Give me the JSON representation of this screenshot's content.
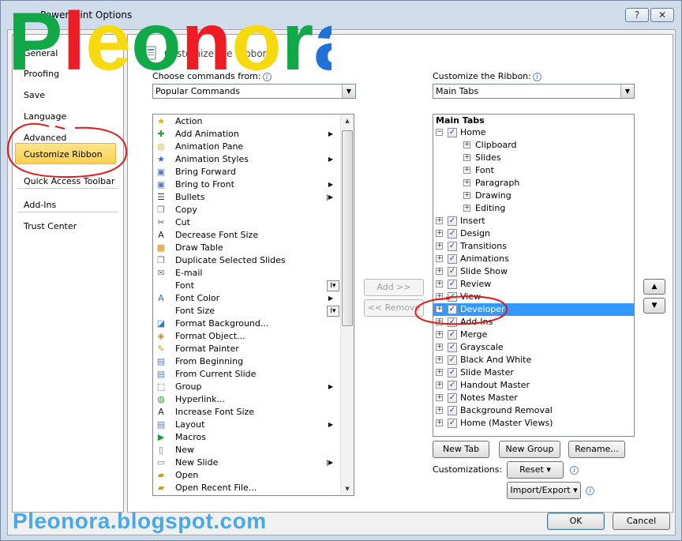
{
  "window": {
    "title": "PowerPoint Options",
    "help_label": "?",
    "close_label": "✕"
  },
  "nav": {
    "items": [
      {
        "label": "General"
      },
      {
        "label": "Proofing"
      },
      {
        "label": "Save"
      },
      {
        "label": "Language"
      },
      {
        "label": "Advanced"
      },
      {
        "label": "Customize Ribbon",
        "selected": true
      },
      {
        "label": "Quick Access Toolbar"
      },
      {
        "label": "Add-Ins"
      },
      {
        "label": "Trust Center"
      }
    ]
  },
  "header": {
    "title": "Customize the Ribbon."
  },
  "left": {
    "choose_label": "Choose commands from:",
    "choose_value": "Popular Commands",
    "commands": [
      {
        "label": "Action",
        "icon": "★"
      },
      {
        "label": "Add Animation",
        "icon": "✚",
        "submenu": true
      },
      {
        "label": "Animation Pane",
        "icon": "◎"
      },
      {
        "label": "Animation Styles",
        "icon": "★",
        "submenu": true
      },
      {
        "label": "Bring Forward",
        "icon": "▣"
      },
      {
        "label": "Bring to Front",
        "icon": "▣",
        "submenu": true
      },
      {
        "label": "Bullets",
        "icon": "☰",
        "submenu_bar": true
      },
      {
        "label": "Copy",
        "icon": "❐"
      },
      {
        "label": "Cut",
        "icon": "✂"
      },
      {
        "label": "Decrease Font Size",
        "icon": "A"
      },
      {
        "label": "Draw Table",
        "icon": "▦"
      },
      {
        "label": "Duplicate Selected Slides",
        "icon": "❐"
      },
      {
        "label": "E-mail",
        "icon": "✉"
      },
      {
        "label": "Font",
        "icon": "",
        "split": "I▾"
      },
      {
        "label": "Font Color",
        "icon": "A",
        "submenu": true
      },
      {
        "label": "Font Size",
        "icon": "",
        "split": "I▾"
      },
      {
        "label": "Format Background...",
        "icon": "◪"
      },
      {
        "label": "Format Object...",
        "icon": "◈"
      },
      {
        "label": "Format Painter",
        "icon": "✎"
      },
      {
        "label": "From Beginning",
        "icon": "▤"
      },
      {
        "label": "From Current Slide",
        "icon": "▤"
      },
      {
        "label": "Group",
        "icon": "⬚",
        "submenu": true
      },
      {
        "label": "Hyperlink...",
        "icon": "◍"
      },
      {
        "label": "Increase Font Size",
        "icon": "A"
      },
      {
        "label": "Layout",
        "icon": "▤",
        "submenu": true
      },
      {
        "label": "Macros",
        "icon": "▶"
      },
      {
        "label": "New",
        "icon": "▯"
      },
      {
        "label": "New Slide",
        "icon": "▭",
        "submenu_bar": true
      },
      {
        "label": "Open",
        "icon": "▰"
      },
      {
        "label": "Open Recent File...",
        "icon": "▰"
      }
    ]
  },
  "middle": {
    "add_label": "Add >>",
    "remove_label": "<< Remove"
  },
  "right": {
    "customize_label": "Customize the Ribbon:",
    "customize_value": "Main Tabs",
    "tree_header": "Main Tabs",
    "tree": [
      {
        "label": "Home",
        "level": 0,
        "expander": "−",
        "checked": true
      },
      {
        "label": "Clipboard",
        "level": 1,
        "expander": "+"
      },
      {
        "label": "Slides",
        "level": 1,
        "expander": "+"
      },
      {
        "label": "Font",
        "level": 1,
        "expander": "+"
      },
      {
        "label": "Paragraph",
        "level": 1,
        "expander": "+"
      },
      {
        "label": "Drawing",
        "level": 1,
        "expander": "+"
      },
      {
        "label": "Editing",
        "level": 1,
        "expander": "+"
      },
      {
        "label": "Insert",
        "level": 0,
        "expander": "+",
        "checked": true
      },
      {
        "label": "Design",
        "level": 0,
        "expander": "+",
        "checked": true
      },
      {
        "label": "Transitions",
        "level": 0,
        "expander": "+",
        "checked": true
      },
      {
        "label": "Animations",
        "level": 0,
        "expander": "+",
        "checked": true
      },
      {
        "label": "Slide Show",
        "level": 0,
        "expander": "+",
        "checked": true
      },
      {
        "label": "Review",
        "level": 0,
        "expander": "+",
        "checked": true
      },
      {
        "label": "View",
        "level": 0,
        "expander": "+",
        "checked": true
      },
      {
        "label": "Developer",
        "level": 0,
        "expander": "+",
        "checked": true,
        "selected": true
      },
      {
        "label": "Add-Ins",
        "level": 0,
        "expander": "+",
        "checked": true
      },
      {
        "label": "Merge",
        "level": 0,
        "expander": "+",
        "checked": true
      },
      {
        "label": "Grayscale",
        "level": 0,
        "expander": "+",
        "checked": true
      },
      {
        "label": "Black And White",
        "level": 0,
        "expander": "+",
        "checked": true
      },
      {
        "label": "Slide Master",
        "level": 0,
        "expander": "+",
        "checked": true
      },
      {
        "label": "Handout Master",
        "level": 0,
        "expander": "+",
        "checked": true
      },
      {
        "label": "Notes Master",
        "level": 0,
        "expander": "+",
        "checked": true
      },
      {
        "label": "Background Removal",
        "level": 0,
        "expander": "+",
        "checked": true
      },
      {
        "label": "Home (Master Views)",
        "level": 0,
        "expander": "+",
        "checked": true
      }
    ],
    "new_tab_label": "New Tab",
    "new_group_label": "New Group",
    "rename_label": "Rename...",
    "customizations_label": "Customizations:",
    "reset_label": "Reset ▾",
    "import_export_label": "Import/Export ▾",
    "up_label": "▲",
    "down_label": "▼"
  },
  "footer": {
    "ok_label": "OK",
    "cancel_label": "Cancel"
  },
  "watermark": {
    "logo_text": "Pleonora",
    "url_text": "Pleonora.blogspot.com"
  },
  "colors": {
    "selection": "#3399ff",
    "nav_selected": "#fbd55e",
    "annotation_red": "#e01818",
    "url_blue": "#4aa8e8"
  }
}
